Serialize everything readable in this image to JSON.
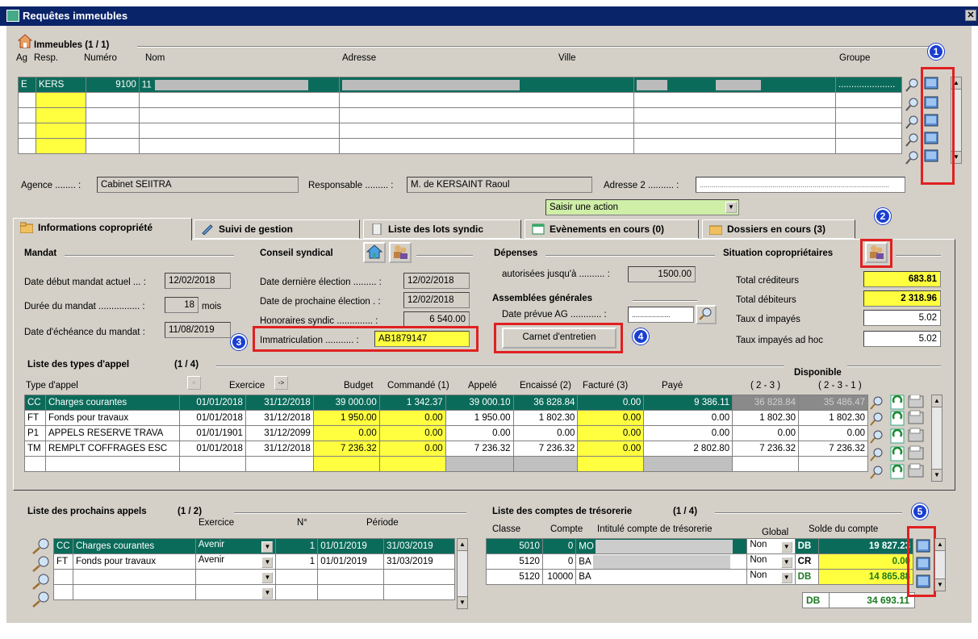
{
  "window": {
    "title": "Requêtes immeubles",
    "close": "✕"
  },
  "immeubles": {
    "title": "Immeubles (1 / 1)",
    "cols": [
      "Ag",
      "Resp.",
      "Numéro",
      "Nom",
      "Adresse",
      "Ville",
      "Groupe"
    ],
    "row": {
      "ag": "E",
      "resp": "KERS",
      "numero": "9100",
      "nom": "11",
      "groupe": "......................"
    },
    "agence_label": "Agence ........ :",
    "agence": "Cabinet SEIITRA",
    "responsable_label": "Responsable ......... :",
    "responsable": "M. de KERSAINT Raoul",
    "adresse2_label": "Adresse 2 .......... :",
    "action": "Saisir une action"
  },
  "tabs": [
    "Informations copropriété",
    "Suivi de gestion",
    "Liste des lots syndic",
    "Evènements en cours (0)",
    "Dossiers en cours (3)"
  ],
  "mandat": {
    "title": "Mandat",
    "debut_label": "Date début mandat actuel ... :",
    "debut": "12/02/2018",
    "duree_label": "Durée du mandat ................ :",
    "duree": "18",
    "duree_unit": "mois",
    "echeance_label": "Date d'échéance du mandat :",
    "echeance": "11/08/2019"
  },
  "conseil": {
    "title": "Conseil syndical",
    "derniere_label": "Date dernière élection ......... :",
    "derniere": "12/02/2018",
    "prochaine_label": "Date de prochaine élection . :",
    "prochaine": "12/02/2018",
    "honoraires_label": "Honoraires syndic .............. :",
    "honoraires": "6 540.00",
    "immat_label": "Immatriculation ........... :",
    "immat": "AB1879147"
  },
  "depenses": {
    "title": "Dépenses",
    "autorisees_label": "autorisées jusqu'à .......... :",
    "autorisees": "1500.00"
  },
  "ag": {
    "title": "Assemblées générales",
    "date_label": "Date prévue AG ............ :",
    "date": "...................",
    "carnet": "Carnet d'entretien"
  },
  "situation": {
    "title": "Situation copropriétaires",
    "crediteurs_label": "Total créditeurs",
    "crediteurs": "683.81",
    "debiteurs_label": "Total débiteurs",
    "debiteurs": "2 318.96",
    "impayes_label": "Taux d impayés",
    "impayes": "5.02",
    "impayes_ah_label": "Taux impayés ad hoc",
    "impayes_ah": "5.02"
  },
  "appels": {
    "title": "Liste des types d'appel",
    "count": "(1 / 4)",
    "disponible": "Disponible",
    "cols": [
      "Type d'appel",
      "Exercice",
      "Budget",
      "Commandé (1)",
      "Appelé",
      "Encaissé (2)",
      "Facturé (3)",
      "Payé",
      "( 2 - 3 )",
      "( 2 - 3 - 1 )"
    ],
    "rows": [
      [
        "CC",
        "Charges courantes",
        "01/01/2018",
        "31/12/2018",
        "39 000.00",
        "1 342.37",
        "39 000.10",
        "36 828.84",
        "0.00",
        "9 386.11",
        "36 828.84",
        "35 486.47"
      ],
      [
        "FT",
        "Fonds pour travaux",
        "01/01/2018",
        "31/12/2018",
        "1 950.00",
        "0.00",
        "1 950.00",
        "1 802.30",
        "0.00",
        "0.00",
        "1 802.30",
        "1 802.30"
      ],
      [
        "P1",
        "APPELS RESERVE TRAVA",
        "01/01/1901",
        "31/12/2099",
        "0.00",
        "0.00",
        "0.00",
        "0.00",
        "0.00",
        "0.00",
        "0.00",
        "0.00"
      ],
      [
        "TM",
        "REMPLT COFFRAGES ESC",
        "01/01/2018",
        "31/12/2018",
        "7 236.32",
        "0.00",
        "7 236.32",
        "7 236.32",
        "0.00",
        "2 802.80",
        "7 236.32",
        "7 236.32"
      ]
    ]
  },
  "prochains": {
    "title": "Liste des prochains appels",
    "count": "(1 / 2)",
    "cols": [
      "Exercice",
      "N°",
      "Période"
    ],
    "rows": [
      [
        "CC",
        "Charges courantes",
        "Avenir",
        "1",
        "01/01/2019",
        "31/03/2019"
      ],
      [
        "FT",
        "Fonds pour travaux",
        "Avenir",
        "1",
        "01/01/2019",
        "31/03/2019"
      ]
    ]
  },
  "tresorerie": {
    "title": "Liste des comptes de trésorerie",
    "count": "(1 / 4)",
    "cols": [
      "Classe",
      "Compte",
      "Intitulé compte de trésorerie",
      "Global",
      "Solde du compte"
    ],
    "rows": [
      [
        "5010",
        "0",
        "MO",
        "Non",
        "DB",
        "19 827.23"
      ],
      [
        "5120",
        "0",
        "BA",
        "Non",
        "CR",
        "0.00"
      ],
      [
        "5120",
        "10000",
        "BA",
        "Non",
        "DB",
        "14 865.88"
      ]
    ],
    "total": {
      "sens": "DB",
      "solde": "34 693.11"
    }
  },
  "markers": [
    "1",
    "2",
    "3",
    "4",
    "5"
  ]
}
